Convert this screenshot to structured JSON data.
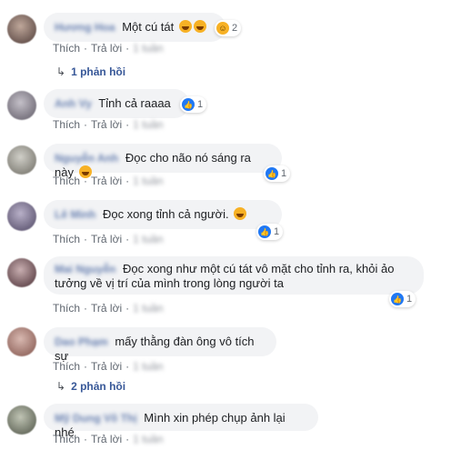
{
  "actions": {
    "like": "Thích",
    "reply": "Trả lời",
    "sep": "·"
  },
  "comments": [
    {
      "author": "Hương Hoa",
      "text": "Một cú tát",
      "reaction_count": "2",
      "time": "1 tuần"
    },
    {
      "author": "Anh Vy",
      "text": "Tỉnh cả raaaa",
      "reaction_count": "1",
      "time": "1 tuần"
    },
    {
      "author": "Nguyễn Anh",
      "text": "Đọc cho não nó sáng ra này",
      "reaction_count": "1",
      "time": "1 tuần"
    },
    {
      "author": "Lê Minh",
      "text": "Đọc xong tỉnh cả người.",
      "reaction_count": "1",
      "time": "1 tuần"
    },
    {
      "author": "Mai Nguyễn",
      "text": "Đọc xong như một cú tát vô mặt cho tỉnh ra, khỏi ảo tưởng về vị trí của mình trong lòng người ta",
      "reaction_count": "1",
      "time": "1 tuần"
    },
    {
      "author": "Dao Phạm",
      "text": "mấy thằng đàn ông vô tích sự",
      "time": "1 tuần"
    },
    {
      "author": "Mỹ Dung Võ Thị",
      "text": "Mình xin phép chụp ảnh lại nhé",
      "time": "1 tuần"
    }
  ],
  "reply_links": {
    "first": "1 phản hồi",
    "second": "2 phản hồi"
  },
  "colors": {
    "like_blue": "#2078f4",
    "link_blue": "#385898",
    "bubble_gray": "#f2f3f5"
  }
}
